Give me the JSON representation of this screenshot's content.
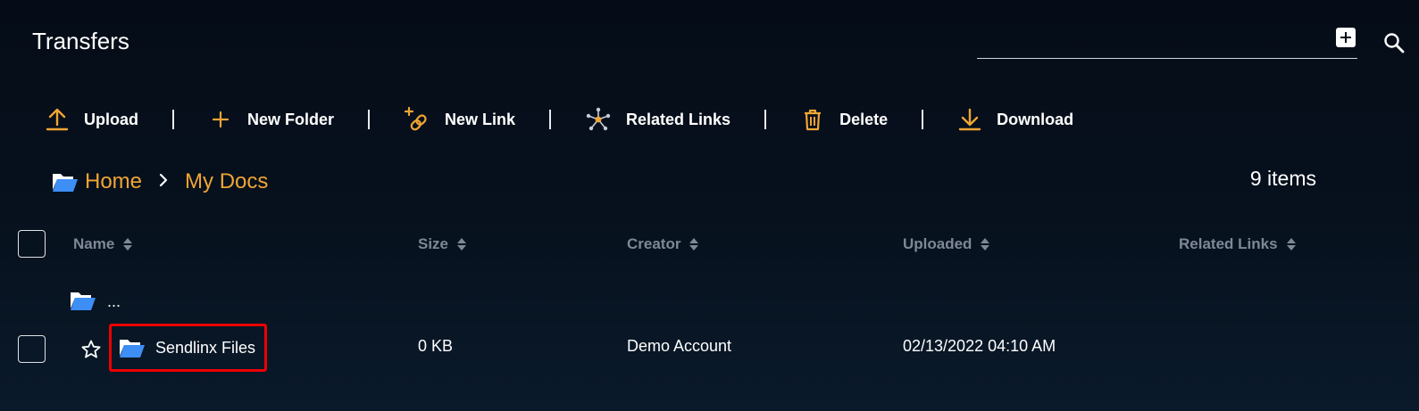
{
  "header": {
    "title": "Transfers",
    "add_icon": "plus-square-icon",
    "search_icon": "search-icon"
  },
  "toolbar": {
    "items": [
      {
        "label": "Upload",
        "icon": "upload-icon"
      },
      {
        "label": "New Folder",
        "icon": "plus-icon"
      },
      {
        "label": "New Link",
        "icon": "link-add-icon"
      },
      {
        "label": "Related Links",
        "icon": "network-icon"
      },
      {
        "label": "Delete",
        "icon": "trash-icon"
      },
      {
        "label": "Download",
        "icon": "download-icon"
      }
    ]
  },
  "breadcrumb": {
    "items": [
      "Home",
      "My Docs"
    ],
    "separator": "›"
  },
  "item_count": "9 items",
  "table": {
    "columns": [
      "Name",
      "Size",
      "Creator",
      "Uploaded",
      "Related Links"
    ],
    "parent_row": {
      "label": "..."
    },
    "rows": [
      {
        "name": "Sendlinx Files",
        "size": "0 KB",
        "creator": "Demo Account",
        "uploaded": "02/13/2022 04:10 AM",
        "related_links": ""
      }
    ]
  },
  "colors": {
    "accent": "#f0a535",
    "folder": "#3d8ef5",
    "highlight_border": "#ee0000",
    "background": "#050c17"
  }
}
